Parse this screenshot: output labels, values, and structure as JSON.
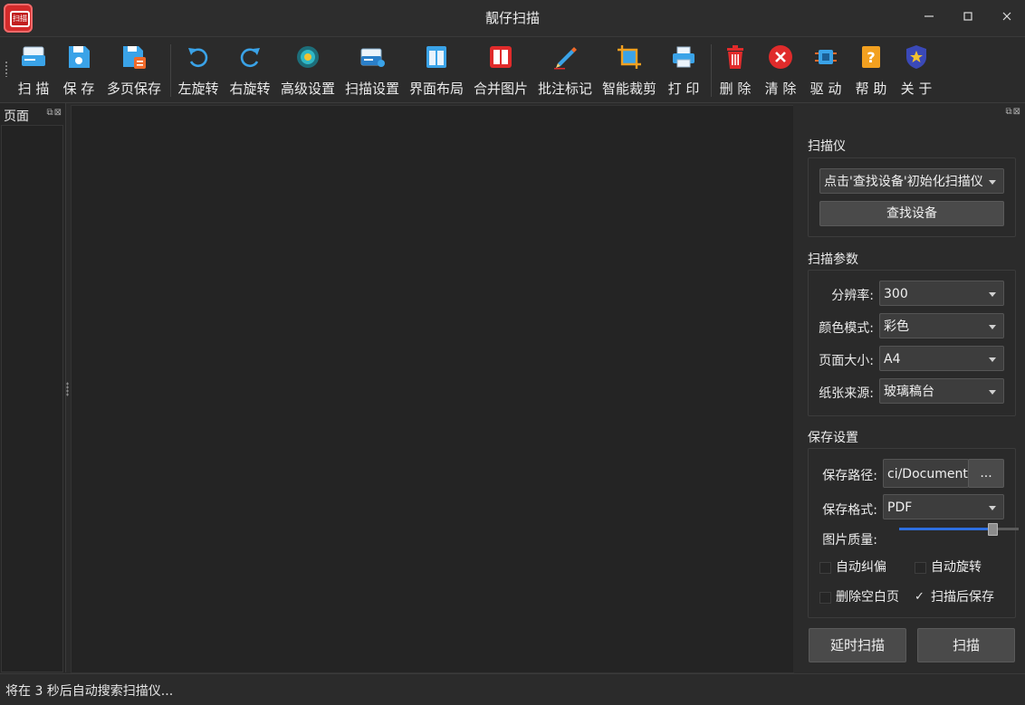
{
  "window": {
    "title": "靓仔扫描",
    "logo_text": "扫描"
  },
  "toolbar": {
    "items": [
      {
        "label": "扫 描",
        "icon": "scanner-icon"
      },
      {
        "label": "保 存",
        "icon": "save-icon"
      },
      {
        "label": "多页保存",
        "icon": "multi-page-save-icon"
      },
      {
        "label": "左旋转",
        "icon": "rotate-left-icon"
      },
      {
        "label": "右旋转",
        "icon": "rotate-right-icon"
      },
      {
        "label": "高级设置",
        "icon": "advanced-settings-icon"
      },
      {
        "label": "扫描设置",
        "icon": "scan-settings-icon"
      },
      {
        "label": "界面布局",
        "icon": "layout-icon"
      },
      {
        "label": "合并图片",
        "icon": "merge-images-icon"
      },
      {
        "label": "批注标记",
        "icon": "annotate-pen-icon"
      },
      {
        "label": "智能裁剪",
        "icon": "smart-crop-icon"
      },
      {
        "label": "打 印",
        "icon": "printer-icon"
      },
      {
        "label": "删 除",
        "icon": "trash-icon"
      },
      {
        "label": "清 除",
        "icon": "clear-icon"
      },
      {
        "label": "驱 动",
        "icon": "driver-chip-icon"
      },
      {
        "label": "帮 助",
        "icon": "help-icon"
      },
      {
        "label": "关 于",
        "icon": "about-shield-icon"
      }
    ]
  },
  "left_panel": {
    "title": "页面"
  },
  "scanner": {
    "group_title": "扫描仪",
    "device_select": "点击'查找设备'初始化扫描仪",
    "find_button": "查找设备"
  },
  "params": {
    "group_title": "扫描参数",
    "resolution_label": "分辨率:",
    "resolution_value": "300",
    "color_label": "颜色模式:",
    "color_value": "彩色",
    "page_size_label": "页面大小:",
    "page_size_value": "A4",
    "source_label": "纸张来源:",
    "source_value": "玻璃稿台"
  },
  "save": {
    "group_title": "保存设置",
    "path_label": "保存路径:",
    "path_value": "ci/Documents",
    "browse_button": "...",
    "format_label": "保存格式:",
    "format_value": "PDF",
    "quality_label": "图片质量:",
    "quality_fraction": 0.77,
    "auto_deskew_label": "自动纠偏",
    "auto_deskew_checked": false,
    "auto_rotate_label": "自动旋转",
    "auto_rotate_checked": false,
    "remove_blank_label": "删除空白页",
    "remove_blank_checked": false,
    "save_after_scan_label": "扫描后保存",
    "save_after_scan_checked": true,
    "check_mark": "✓"
  },
  "actions": {
    "delay_scan": "延时扫描",
    "scan": "扫描"
  },
  "status": {
    "text": "将在 3 秒后自动搜索扫描仪..."
  },
  "colors": {
    "accent": "#2e6fe0",
    "danger": "#e02b2b",
    "toolbar_blue": "#3aa3e8",
    "warning": "#f2a020"
  }
}
